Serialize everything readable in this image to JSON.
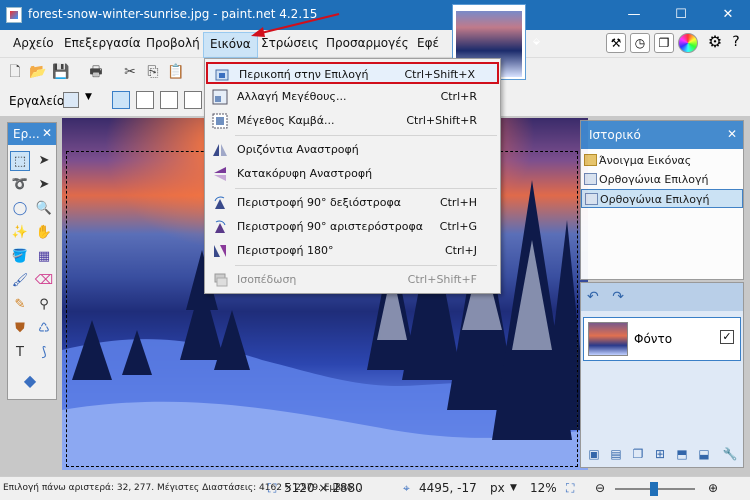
{
  "window": {
    "title": "forest-snow-winter-sunrise.jpg - paint.net 4.2.15",
    "minimize": "—",
    "maximize": "☐",
    "close": "✕"
  },
  "menubar": {
    "items": [
      "Αρχείο",
      "Επεξεργασία",
      "Προβολή",
      "Εικόνα",
      "Στρώσεις",
      "Προσαρμογές",
      "Εφέ"
    ],
    "active": "Εικόνα"
  },
  "toolbar2": {
    "tool_label": "Εργαλείο:"
  },
  "image_menu": {
    "items": [
      {
        "label": "Περικοπή στην Επιλογή",
        "shortcut": "Ctrl+Shift+X",
        "icon": "crop-icon",
        "highlighted": true
      },
      {
        "label": "Αλλαγή Μεγέθους...",
        "shortcut": "Ctrl+R",
        "icon": "resize-icon"
      },
      {
        "label": "Μέγεθος Καμβά...",
        "shortcut": "Ctrl+Shift+R",
        "icon": "canvas-size-icon"
      },
      {
        "label": "Οριζόντια Αναστροφή",
        "shortcut": "",
        "icon": "flip-horizontal-icon"
      },
      {
        "label": "Κατακόρυφη Αναστροφή",
        "shortcut": "",
        "icon": "flip-vertical-icon"
      },
      {
        "label": "Περιστροφή 90° δεξιόστροφα",
        "shortcut": "Ctrl+H",
        "icon": "rotate-cw-icon"
      },
      {
        "label": "Περιστροφή 90° αριστερόστροφα",
        "shortcut": "Ctrl+G",
        "icon": "rotate-ccw-icon"
      },
      {
        "label": "Περιστροφή 180°",
        "shortcut": "Ctrl+J",
        "icon": "rotate-180-icon"
      },
      {
        "label": "Ισοπέδωση",
        "shortcut": "Ctrl+Shift+F",
        "icon": "flatten-icon",
        "disabled": true
      }
    ]
  },
  "tools_panel": {
    "title": "Ερ..."
  },
  "history_panel": {
    "title": "Ιστορικό",
    "items": [
      "Άνοιγμα Εικόνας",
      "Ορθογώνια Επιλογή",
      "Ορθογώνια Επιλογή"
    ]
  },
  "layers_panel": {
    "layer_name": "Φόντο",
    "checked": true
  },
  "statusbar": {
    "selection_info": "Επιλογή πάνω αριστερά: 32, 277. Μέγιστες Διαστάσεις: 4162 × 2579. Εμβαδ...",
    "image_size": "5120 × 2880",
    "cursor": "4495, -17",
    "unit": "px",
    "zoom": "12%"
  },
  "colors": {
    "titlebar": "#1f6fb8",
    "highlight_border": "#d10f1b",
    "panel_header": "#3f88cf"
  }
}
